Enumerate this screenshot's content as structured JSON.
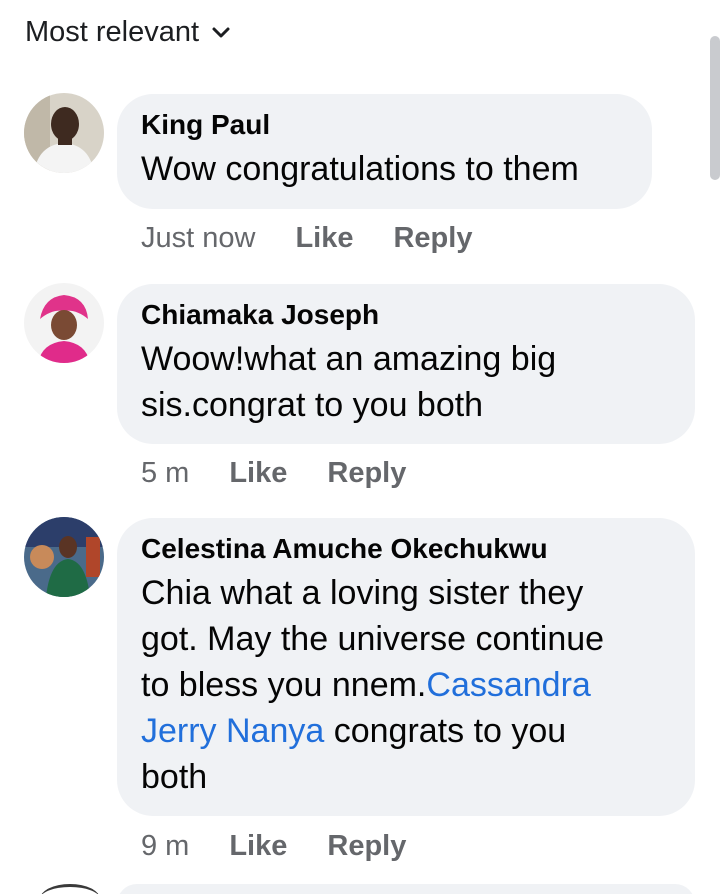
{
  "sort": {
    "label": "Most relevant",
    "icon": "chevron-down-icon"
  },
  "comments": [
    {
      "name": "King Paul",
      "text": "Wow congratulations to them",
      "time": "Just now",
      "like": "Like",
      "reply": "Reply"
    },
    {
      "name": "Chiamaka Joseph",
      "text_line1": "Woow!what an amazing big",
      "text_line2": "sis.congrat to you both",
      "time": "5 m",
      "like": "Like",
      "reply": "Reply"
    },
    {
      "name": "Celestina Amuche Okechukwu",
      "text_line1": "Chia what a loving sister they",
      "text_line2": "got. May the universe continue",
      "text_line3a": "to bless you nnem.",
      "mention_part1": "Cassandra",
      "mention_part2": "Jerry Nanya",
      "text_line4b": " congrats to you",
      "text_line5": "both",
      "time": "9 m",
      "like": "Like",
      "reply": "Reply"
    }
  ],
  "colors": {
    "bubble": "#f0f2f5",
    "meta_text": "#65676b",
    "mention": "#216fdb"
  }
}
